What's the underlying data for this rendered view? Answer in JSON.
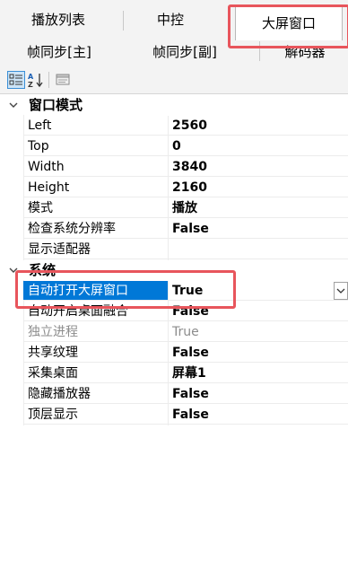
{
  "tabs": {
    "row1": [
      {
        "label": "播放列表"
      },
      {
        "label": "中控"
      },
      {
        "label": "大屏窗口",
        "active": true
      }
    ],
    "row2": [
      {
        "label": "帧同步[主]"
      },
      {
        "label": "帧同步[副]"
      },
      {
        "label": "解码器"
      }
    ]
  },
  "toolbar": {
    "categorized_icon": "categorized-view-icon",
    "alphabetical_icon": "alphabetical-sort-icon",
    "property_pages_icon": "property-pages-icon"
  },
  "categories": [
    {
      "label": "窗口模式",
      "expanded": true,
      "properties": [
        {
          "name": "Left",
          "value": "2560"
        },
        {
          "name": "Top",
          "value": "0"
        },
        {
          "name": "Width",
          "value": "3840"
        },
        {
          "name": "Height",
          "value": "2160"
        },
        {
          "name": "模式",
          "value": "播放"
        },
        {
          "name": "检查系统分辨率",
          "value": "False"
        },
        {
          "name": "显示适配器",
          "value": ""
        }
      ]
    },
    {
      "label": "系统",
      "expanded": true,
      "properties": [
        {
          "name": "自动打开大屏窗口",
          "value": "True",
          "selected": true
        },
        {
          "name": "自动开启桌面融合",
          "value": "False"
        },
        {
          "name": "独立进程",
          "value": "True",
          "disabled": true
        },
        {
          "name": "共享纹理",
          "value": "False"
        },
        {
          "name": "采集桌面",
          "value": "屏幕1"
        },
        {
          "name": "隐藏播放器",
          "value": "False"
        },
        {
          "name": "顶层显示",
          "value": "False"
        }
      ]
    }
  ],
  "colors": {
    "highlight_box": "#e8555c",
    "selection": "#0078d7",
    "toolbar_active": "#cce4f7"
  }
}
